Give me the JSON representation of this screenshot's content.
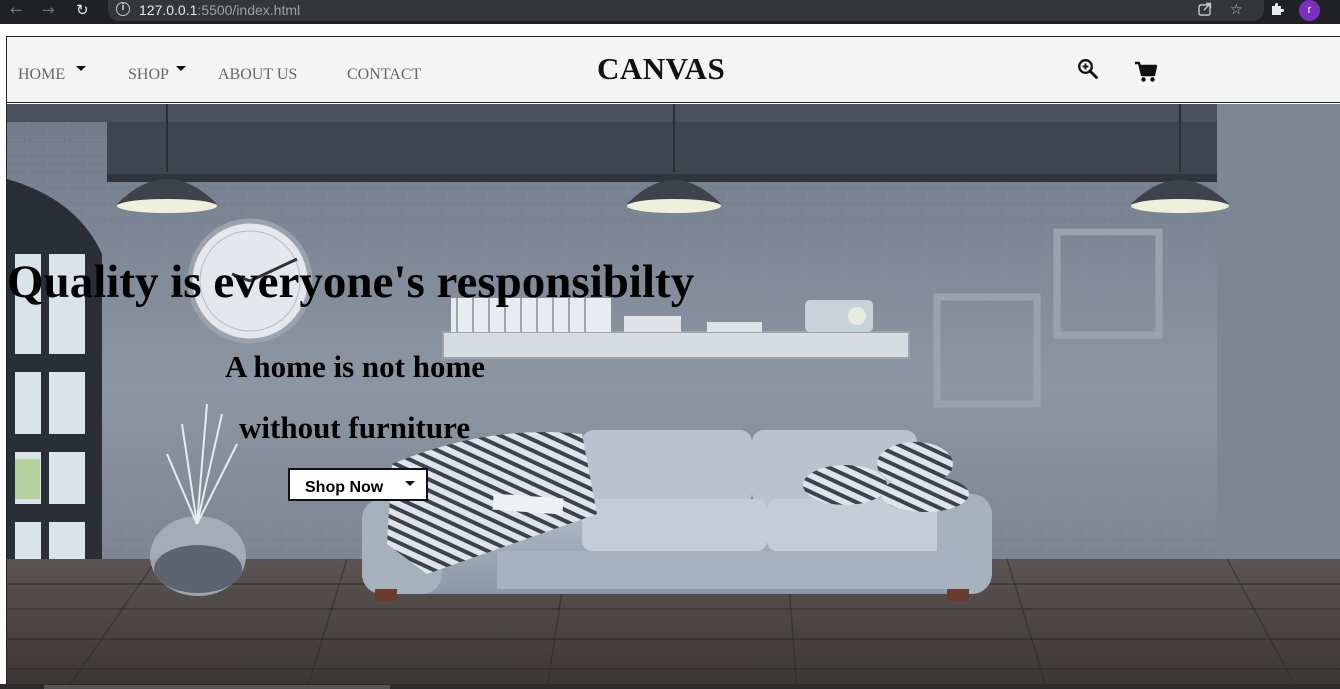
{
  "browser": {
    "url_host": "127.0.0.1",
    "url_rest": ":5500/index.html",
    "avatar_letter": "r",
    "icons": [
      "back-arrow-icon",
      "forward-arrow-icon",
      "reload-icon",
      "info-icon",
      "share-icon",
      "bookmark-star-icon",
      "extensions-puzzle-icon"
    ]
  },
  "navbar": {
    "items": [
      {
        "label": "HOME",
        "has_dropdown": true
      },
      {
        "label": "SHOP",
        "has_dropdown": true
      },
      {
        "label": "ABOUT US",
        "has_dropdown": false
      },
      {
        "label": "CONTACT",
        "has_dropdown": false
      }
    ],
    "brand": "CANVAS",
    "icons": [
      "zoom-search-icon",
      "cart-icon"
    ]
  },
  "hero": {
    "headline": "Quality is everyone's responsibilty",
    "subline_1": "A home is not home",
    "subline_2": "without furniture",
    "cta_label": "Shop Now",
    "background": "living room photo with grey sofa, pendant lamps, wall clock and shelf"
  },
  "colors": {
    "navbar_bg": "#f4f4f4",
    "nav_text": "#666666",
    "brand_text": "#111111",
    "chrome_bg": "#202124",
    "avatar_bg": "#7b2fbf"
  }
}
